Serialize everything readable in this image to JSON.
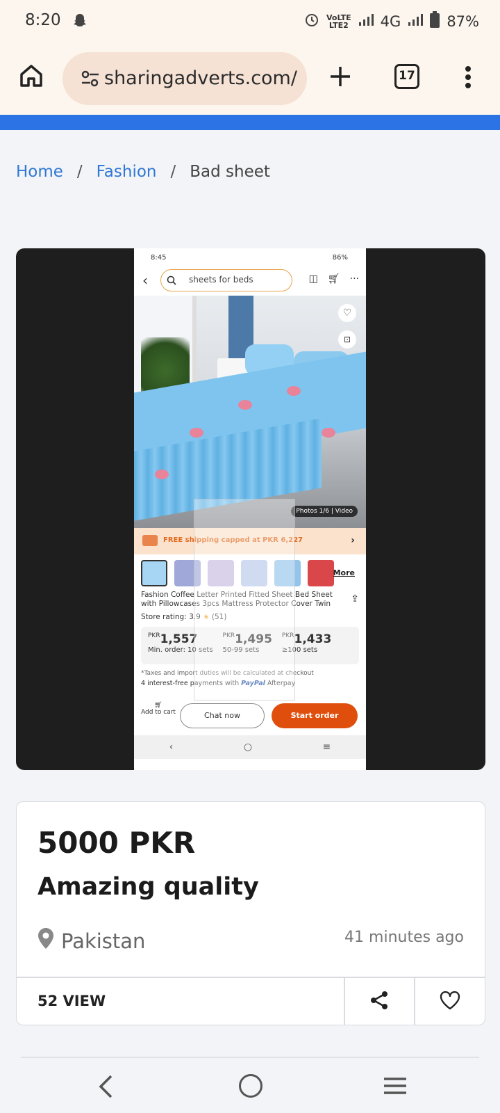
{
  "status_bar": {
    "time": "8:20",
    "network": "4G",
    "volte_top": "VoLTE",
    "volte_bottom": "LTE2",
    "battery": "87%"
  },
  "browser": {
    "url": "sharingadverts.com/",
    "tab_count": "17"
  },
  "breadcrumb": {
    "home": "Home",
    "category": "Fashion",
    "current": "Bad sheet",
    "separator": "/"
  },
  "listing_image": {
    "status_time": "8:45",
    "status_right": "86%",
    "search_text": "sheets for beds",
    "photos_badge": "Photos 1/6 | Video",
    "shipping_text": "FREE shipping capped at PKR 6,227",
    "more_label": "More",
    "product_title": "Fashion Coffee Letter Printed Fitted Sheet Bed Sheet with Pillowcases 3pcs Mattress Protector Cover Twin",
    "store_rating_label": "Store rating: 3.9",
    "store_rating_count": "(51)",
    "prices": [
      {
        "currency": "PKR",
        "value": "1,557",
        "min": "Min. order: 10 sets"
      },
      {
        "currency": "PKR",
        "value": "1,495",
        "min": "50-99 sets"
      },
      {
        "currency": "PKR",
        "value": "1,433",
        "min": "≥100 sets"
      }
    ],
    "tax_note": "*Taxes and import duties will be calculated at checkout",
    "interest_text": "4 interest-free payments with",
    "paypal": "PayPal",
    "afterpay": "Afterpay",
    "add_to_cart": "Add to cart",
    "chat_now": "Chat now",
    "start_order": "Start order"
  },
  "listing": {
    "price": "5000 PKR",
    "title": "Amazing quality",
    "location": "Pakistan",
    "posted": "41 minutes ago",
    "views": "52 VIEW"
  },
  "icons": {
    "home": "home-icon",
    "site_settings": "tune-icon",
    "new_tab": "plus-icon",
    "tabs": "tab-switcher-icon",
    "menu": "more-vert-icon",
    "location": "location-pin-icon",
    "share": "share-icon",
    "favorite": "heart-icon"
  },
  "colors": {
    "link": "#2f78d4",
    "top_bar": "#2c74e6",
    "start_order": "#e04e0e"
  }
}
